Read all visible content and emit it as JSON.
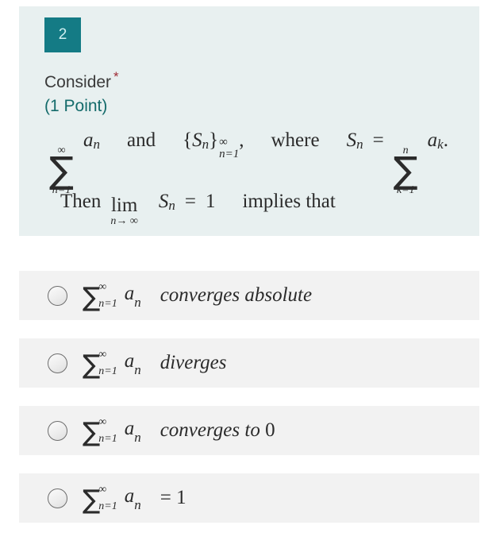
{
  "question": {
    "number": "2",
    "prompt": "Consider",
    "required_marker": "*",
    "points": "(1 Point)",
    "badge_color": "#147b85",
    "panel_color": "#e8f0f0",
    "points_color": "#146b6b",
    "required_color": "#9e2b35",
    "math": {
      "sum_symbol": "∑",
      "infinity": "∞",
      "series_index_lower": "n=1",
      "series_term": "a",
      "series_term_sub": "n",
      "conjunction": "and",
      "sequence_open": "{",
      "sequence_symbol": "S",
      "sequence_sub": "n",
      "sequence_close": "}",
      "sequence_sup": "∞",
      "sequence_lower": "n=1",
      "comma": ",",
      "where_word": "where",
      "partial_sum_symbol": "S",
      "partial_sum_sub": "n",
      "equals": "=",
      "partial_upper": "n",
      "partial_lower": "k=1",
      "partial_term": "a",
      "partial_term_sub": "k",
      "period": ".",
      "then_word": "Then",
      "lim_word": "lim",
      "lim_under": "n→ ∞",
      "lim_target": "S",
      "lim_target_sub": "n",
      "lim_equals": "=",
      "lim_value": "1",
      "implies_text": "implies that"
    }
  },
  "options": [
    {
      "id": "option-1",
      "sum_symbol": "∑",
      "upper": "∞",
      "lower": "n=1",
      "term": "a",
      "term_sub": "n",
      "text": "converges  absolute",
      "selected": false
    },
    {
      "id": "option-2",
      "sum_symbol": "∑",
      "upper": "∞",
      "lower": "n=1",
      "term": "a",
      "term_sub": "n",
      "text": "diverges",
      "selected": false
    },
    {
      "id": "option-3",
      "sum_symbol": "∑",
      "upper": "∞",
      "lower": "n=1",
      "term": "a",
      "term_sub": "n",
      "text": "converges to ",
      "text_upright": "0",
      "selected": false
    },
    {
      "id": "option-4",
      "sum_symbol": "∑",
      "upper": "∞",
      "lower": "n=1",
      "term": "a",
      "term_sub": "n",
      "text": "= ",
      "text_upright": "1",
      "selected": false
    }
  ]
}
